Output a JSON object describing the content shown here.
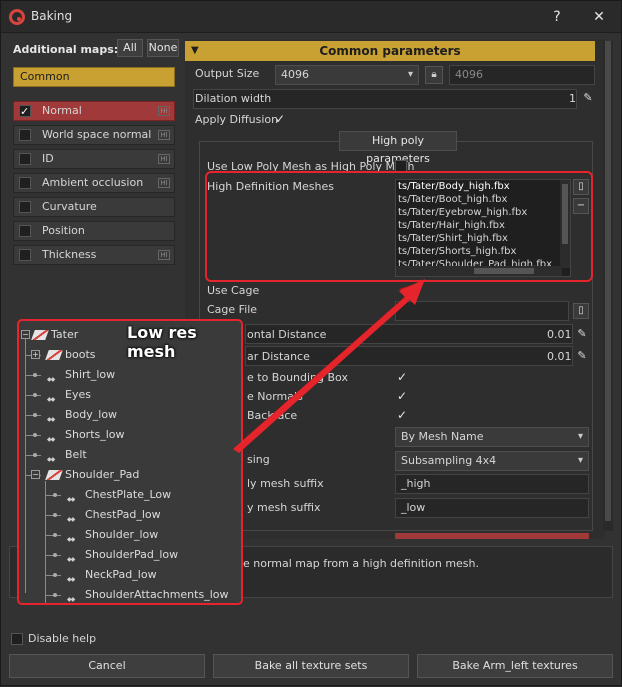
{
  "window": {
    "title": "Baking"
  },
  "titlebar": {
    "help": "?",
    "close": "✕"
  },
  "left": {
    "additional_maps": "Additional maps:",
    "all_label": "All",
    "none_label": "None",
    "common_label": "Common",
    "maps": [
      {
        "label": "Normal",
        "checked": true,
        "hi": true,
        "selected": true
      },
      {
        "label": "World space normal",
        "checked": false,
        "hi": true
      },
      {
        "label": "ID",
        "checked": false,
        "hi": true
      },
      {
        "label": "Ambient occlusion",
        "checked": false,
        "hi": true
      },
      {
        "label": "Curvature",
        "checked": false,
        "hi": false
      },
      {
        "label": "Position",
        "checked": false,
        "hi": false
      },
      {
        "label": "Thickness",
        "checked": false,
        "hi": true
      }
    ],
    "hi_badge": "HI"
  },
  "params": {
    "section_title": "Common parameters",
    "output_size_label": "Output Size",
    "output_size_value": "4096",
    "output_size_value2": "4096",
    "dilation_label": "Dilation width",
    "dilation_value": "1",
    "apply_diffusion_label": "Apply Diffusion",
    "high_poly_header": "High poly parameters",
    "use_low_poly_label": "Use Low Poly Mesh as High Poly Mesh",
    "hd_meshes_label": "High Definition Meshes",
    "meshes": [
      "ts/Tater/Body_high.fbx",
      "ts/Tater/Boot_high.fbx",
      "ts/Tater/Eyebrow_high.fbx",
      "ts/Tater/Hair_high.fbx",
      "ts/Tater/Shirt_high.fbx",
      "ts/Tater/Shorts_high.fbx",
      "ts/Tater/Shoulder_Pad_high.fbx"
    ],
    "use_cage_label": "Use Cage",
    "cage_file_label": "Cage File",
    "frontal_label": "ontal Distance",
    "frontal_value": "0.01",
    "rear_label": "ar Distance",
    "rear_value": "0.01",
    "bbox_label": "e to Bounding Box",
    "normals_label": "e Normals",
    "backface_label": "Backface",
    "match_value": "By Mesh Name",
    "antialias_label": "sing",
    "antialias_value": "Subsampling 4x4",
    "high_suffix_label": "ly mesh suffix",
    "high_suffix_value": "_high",
    "low_suffix_label": "y mesh suffix",
    "low_suffix_value": "_low"
  },
  "description": {
    "text": "e normal map from a high definition mesh."
  },
  "tree": {
    "overlay_label": "Low res mesh",
    "root": "Tater",
    "items": [
      {
        "label": "boots",
        "kind": "obj",
        "level": 1,
        "expandable": true
      },
      {
        "label": "Shirt_low",
        "kind": "mesh",
        "level": 1
      },
      {
        "label": "Eyes",
        "kind": "mesh",
        "level": 1
      },
      {
        "label": "Body_low",
        "kind": "mesh",
        "level": 1
      },
      {
        "label": "Shorts_low",
        "kind": "mesh",
        "level": 1
      },
      {
        "label": "Belt",
        "kind": "mesh",
        "level": 1
      },
      {
        "label": "Shoulder_Pad",
        "kind": "obj",
        "level": 1,
        "expanded": true
      },
      {
        "label": "ChestPlate_Low",
        "kind": "mesh",
        "level": 2
      },
      {
        "label": "ChestPad_low",
        "kind": "mesh",
        "level": 2
      },
      {
        "label": "Shoulder_low",
        "kind": "mesh",
        "level": 2
      },
      {
        "label": "ShoulderPad_low",
        "kind": "mesh",
        "level": 2
      },
      {
        "label": "NeckPad_low",
        "kind": "mesh",
        "level": 2
      },
      {
        "label": "ShoulderAttachments_low",
        "kind": "mesh",
        "level": 2
      }
    ]
  },
  "footer": {
    "disable_help": "Disable help",
    "cancel": "Cancel",
    "bake_all": "Bake all texture sets",
    "bake_arm": "Bake Arm_left textures"
  },
  "colors": {
    "accent": "#c9a032",
    "selection": "#a03a3a",
    "annotation": "#e5242b"
  }
}
